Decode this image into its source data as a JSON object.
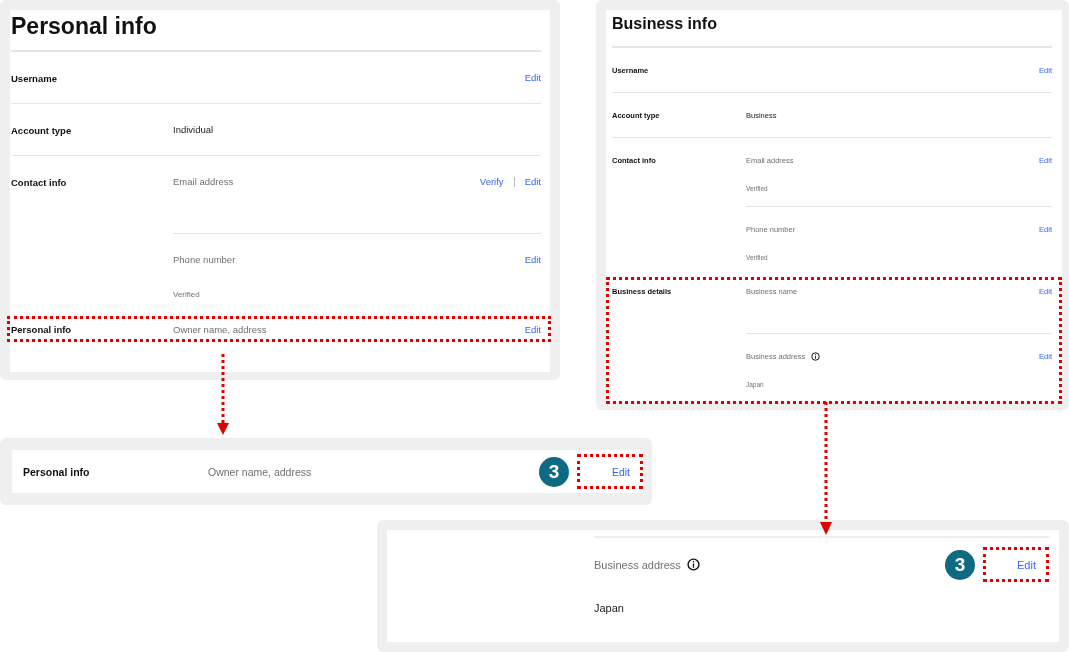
{
  "personal_panel": {
    "title": "Personal info",
    "sections": [
      {
        "label": "Username",
        "highlighted": false,
        "entries": [
          {
            "kind": "action-only",
            "actions": [
              "Edit"
            ]
          }
        ]
      },
      {
        "label": "Account type",
        "highlighted": false,
        "entries": [
          {
            "kind": "value",
            "text": "Individual"
          }
        ]
      },
      {
        "label": "Contact info",
        "highlighted": false,
        "entries": [
          {
            "kind": "field",
            "text": "Email address",
            "actions": [
              "Verify",
              "Edit"
            ]
          },
          {
            "kind": "field",
            "text": "Phone number",
            "note": "Verified",
            "actions": [
              "Edit"
            ]
          }
        ]
      },
      {
        "label": "Personal info",
        "highlighted": true,
        "entries": [
          {
            "kind": "field",
            "text": "Owner name, address",
            "actions": [
              "Edit"
            ]
          }
        ]
      }
    ]
  },
  "business_panel": {
    "title": "Business info",
    "sections": [
      {
        "label": "Username",
        "highlighted": false,
        "entries": [
          {
            "kind": "action-only",
            "actions": [
              "Edit"
            ]
          }
        ]
      },
      {
        "label": "Account type",
        "highlighted": false,
        "entries": [
          {
            "kind": "value",
            "text": "Business"
          }
        ]
      },
      {
        "label": "Contact info",
        "highlighted": false,
        "entries": [
          {
            "kind": "field",
            "text": "Email address",
            "note": "Verified",
            "actions": [
              "Edit"
            ]
          },
          {
            "kind": "field",
            "text": "Phone number",
            "note": "Verified",
            "actions": [
              "Edit"
            ]
          }
        ]
      },
      {
        "label": "Business details",
        "highlighted": true,
        "entries": [
          {
            "kind": "field",
            "text": "Business name",
            "actions": [
              "Edit"
            ]
          },
          {
            "kind": "field-info",
            "text": "Business address",
            "note": "Japan",
            "actions": [
              "Edit"
            ]
          }
        ]
      }
    ]
  },
  "personal_zoom": {
    "label": "Personal info",
    "text": "Owner name, address",
    "step": "3",
    "action": "Edit"
  },
  "business_zoom": {
    "text": "Business address",
    "note": "Japan",
    "step": "3",
    "action": "Edit"
  }
}
